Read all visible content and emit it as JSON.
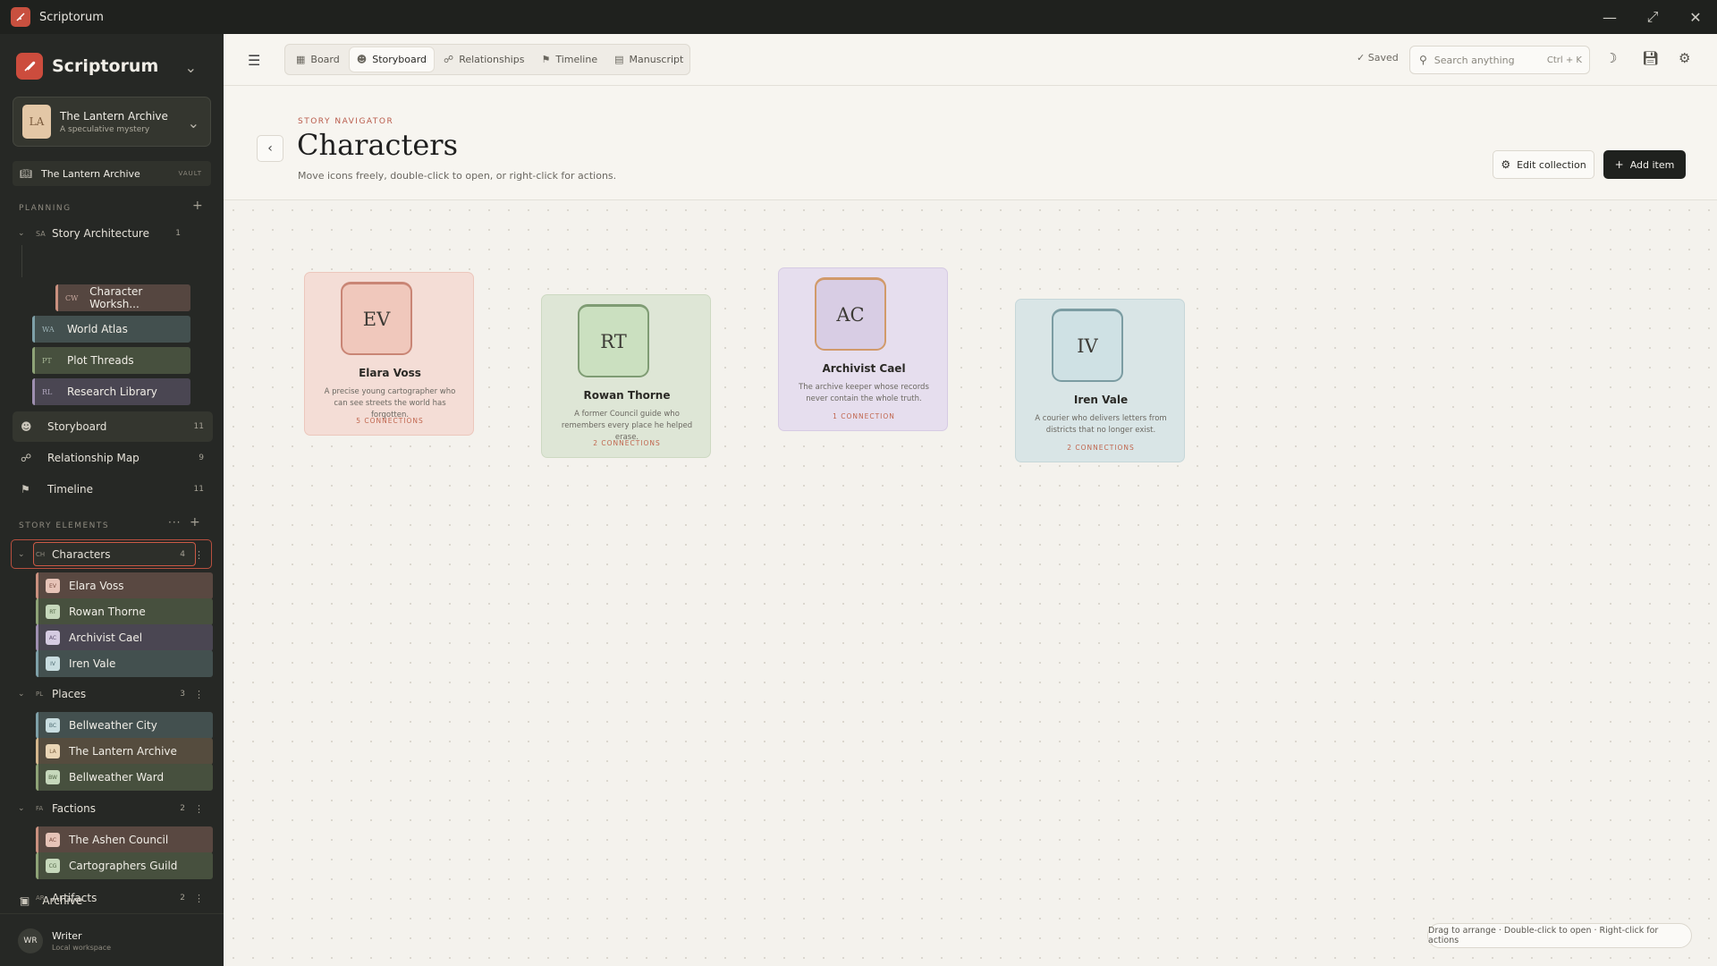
{
  "window": {
    "title": "Scriptorum"
  },
  "sidebar": {
    "brand": "Scriptorum",
    "project": {
      "avatar": "LA",
      "title": "The Lantern Archive",
      "subtitle": "A speculative mystery"
    },
    "vault": {
      "label": "The Lantern Archive",
      "tag": "VAULT"
    },
    "planning": {
      "label": "PLANNING",
      "story_architecture": {
        "abbr": "SA",
        "label": "Story Architecture",
        "count": "1"
      },
      "items": [
        {
          "abbr": "CW",
          "label": "Character Worksh...",
          "color": "#c9907f"
        },
        {
          "abbr": "WA",
          "label": "World Atlas",
          "color": "#7ea0a8"
        },
        {
          "abbr": "PT",
          "label": "Plot Threads",
          "color": "#8ea377"
        },
        {
          "abbr": "RL",
          "label": "Research Library",
          "color": "#9e8fb0"
        }
      ]
    },
    "nav": [
      {
        "label": "Storyboard",
        "count": "11"
      },
      {
        "label": "Relationship Map",
        "count": "9"
      },
      {
        "label": "Timeline",
        "count": "11"
      }
    ],
    "story_elements": {
      "label": "STORY ELEMENTS",
      "groups": [
        {
          "abbr": "CH",
          "label": "Characters",
          "count": "4",
          "items": [
            {
              "abbr": "EV",
              "label": "Elara Voss"
            },
            {
              "abbr": "RT",
              "label": "Rowan Thorne"
            },
            {
              "abbr": "AC",
              "label": "Archivist Cael"
            },
            {
              "abbr": "IV",
              "label": "Iren Vale"
            }
          ]
        },
        {
          "abbr": "PL",
          "label": "Places",
          "count": "3",
          "items": [
            {
              "abbr": "BC",
              "label": "Bellweather City"
            },
            {
              "abbr": "LA",
              "label": "The Lantern Archive"
            },
            {
              "abbr": "BW",
              "label": "Bellweather Ward"
            }
          ]
        },
        {
          "abbr": "FA",
          "label": "Factions",
          "count": "2",
          "items": [
            {
              "abbr": "AC",
              "label": "The Ashen Council"
            },
            {
              "abbr": "CG",
              "label": "Cartographers Guild"
            }
          ]
        },
        {
          "abbr": "AR",
          "label": "Artifacts",
          "count": "2",
          "items": []
        }
      ]
    },
    "archive": "Archive",
    "user": {
      "avatar": "WR",
      "name": "Writer",
      "subtitle": "Local workspace"
    }
  },
  "toolbar": {
    "tabs": [
      {
        "label": "Board",
        "icon": "board-icon"
      },
      {
        "label": "Storyboard",
        "icon": "person-icon"
      },
      {
        "label": "Relationships",
        "icon": "network-icon"
      },
      {
        "label": "Timeline",
        "icon": "signpost-icon"
      },
      {
        "label": "Manuscript",
        "icon": "document-icon"
      }
    ],
    "saved": "Saved",
    "search_placeholder": "Search anything",
    "search_shortcut": "Ctrl + K"
  },
  "header": {
    "eyebrow": "STORY NAVIGATOR",
    "title": "Characters",
    "subtitle": "Move icons freely, double-click to open, or right-click for actions.",
    "edit_label": "Edit collection",
    "add_label": "Add item"
  },
  "cards": [
    {
      "initials": "EV",
      "name": "Elara Voss",
      "desc": "A precise young cartographer who can see streets the world has forgotten.",
      "connections": "5 CONNECTIONS",
      "bg": "#f4ddd6",
      "border": "#ecc7bc",
      "avatar_bg": "#f0c8bc",
      "avatar_border": "#c98575"
    },
    {
      "initials": "RT",
      "name": "Rowan Thorne",
      "desc": "A former Council guide who remembers every place he helped erase.",
      "connections": "2 CONNECTIONS",
      "bg": "#dee6d6",
      "border": "#cdd9c2",
      "avatar_bg": "#cbe0c0",
      "avatar_border": "#7f9c74"
    },
    {
      "initials": "AC",
      "name": "Archivist Cael",
      "desc": "The archive keeper whose records never contain the whole truth.",
      "connections": "1 CONNECTION",
      "bg": "#e6deee",
      "border": "#d6cbe3",
      "avatar_bg": "#d8cde4",
      "avatar_border": "#d19a6a"
    },
    {
      "initials": "IV",
      "name": "Iren Vale",
      "desc": "A courier who delivers letters from districts that no longer exist.",
      "connections": "2 CONNECTIONS",
      "bg": "#d9e5e6",
      "border": "#c6d7d9",
      "avatar_bg": "#cfe1e4",
      "avatar_border": "#7b9ca2"
    }
  ],
  "hint": "Drag to arrange · Double-click to open · Right-click for actions",
  "colors": {
    "accent": "#cc4c3d",
    "sidebar_bg": "#262825",
    "chip_colors": {
      "Elara Voss": "#c9907f",
      "Rowan Thorne": "#8ea377",
      "Archivist Cael": "#9e8fb0",
      "Iren Vale": "#7ea0a8",
      "Bellweather City": "#7ea0a8",
      "The Lantern Archive": "#d3b68c",
      "Bellweather Ward": "#8ea377",
      "The Ashen Council": "#c9907f",
      "Cartographers Guild": "#8ea377"
    }
  }
}
